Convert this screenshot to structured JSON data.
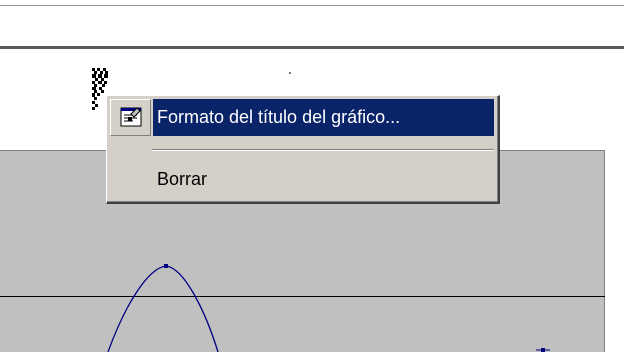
{
  "context_menu": {
    "items": [
      {
        "label": "Formato del título del gráfico...",
        "icon": "format-properties-icon",
        "highlighted": true
      },
      {
        "label": "Borrar",
        "highlighted": false
      }
    ]
  },
  "colors": {
    "menu_background": "#d4d0c8",
    "menu_highlight": "#0a246a",
    "plot_background": "#c0c0c0",
    "series_line": "#000080"
  }
}
